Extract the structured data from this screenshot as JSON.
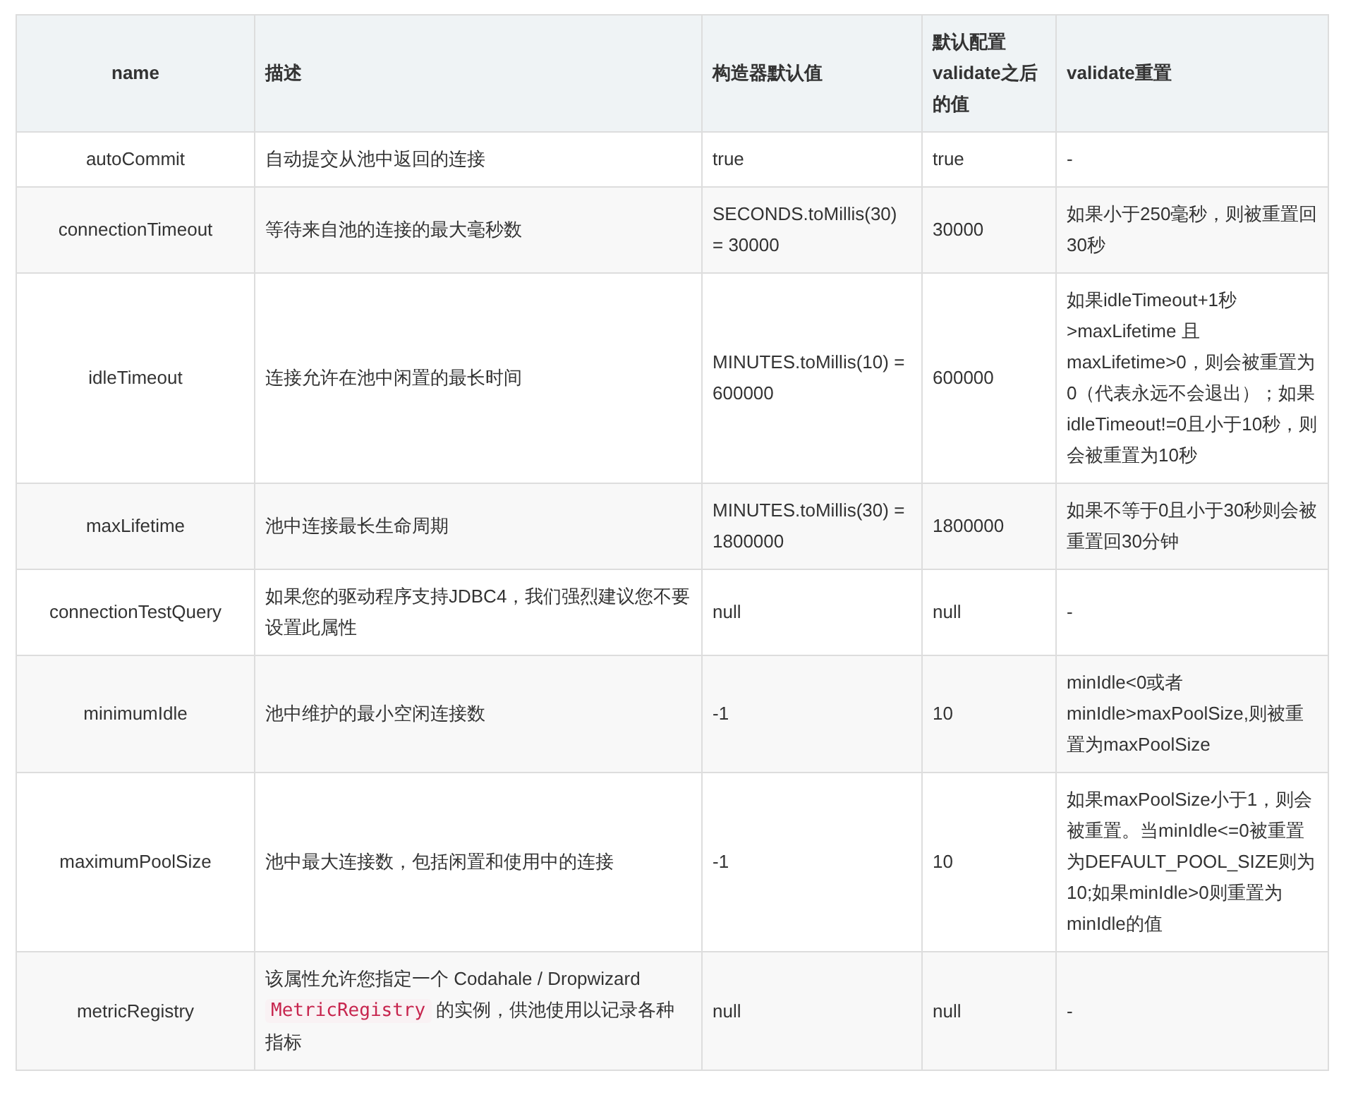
{
  "table": {
    "columns": [
      "name",
      "描述",
      "构造器默认值",
      "默认配置validate之后的值",
      "validate重置"
    ],
    "rows": [
      {
        "name": "autoCommit",
        "description": [
          {
            "kind": "text",
            "text": "自动提交从池中返回的连接"
          }
        ],
        "default": "true",
        "validated": "true",
        "reset": "-"
      },
      {
        "name": "connectionTimeout",
        "description": [
          {
            "kind": "text",
            "text": "等待来自池的连接的最大毫秒数"
          }
        ],
        "default": "SECONDS.toMillis(30) = 30000",
        "validated": "30000",
        "reset": "如果小于250毫秒，则被重置回30秒"
      },
      {
        "name": "idleTimeout",
        "description": [
          {
            "kind": "text",
            "text": "连接允许在池中闲置的最长时间"
          }
        ],
        "default": "MINUTES.toMillis(10) = 600000",
        "validated": "600000",
        "reset": "如果idleTimeout+1秒>maxLifetime 且 maxLifetime>0，则会被重置为0（代表永远不会退出）；如果idleTimeout!=0且小于10秒，则会被重置为10秒"
      },
      {
        "name": "maxLifetime",
        "description": [
          {
            "kind": "text",
            "text": "池中连接最长生命周期"
          }
        ],
        "default": "MINUTES.toMillis(30) = 1800000",
        "validated": "1800000",
        "reset": "如果不等于0且小于30秒则会被重置回30分钟"
      },
      {
        "name": "connectionTestQuery",
        "description": [
          {
            "kind": "text",
            "text": "如果您的驱动程序支持JDBC4，我们强烈建议您不要设置此属性"
          }
        ],
        "default": "null",
        "validated": "null",
        "reset": "-"
      },
      {
        "name": "minimumIdle",
        "description": [
          {
            "kind": "text",
            "text": "池中维护的最小空闲连接数"
          }
        ],
        "default": "-1",
        "validated": "10",
        "reset": "minIdle<0或者minIdle>maxPoolSize,则被重置为maxPoolSize"
      },
      {
        "name": "maximumPoolSize",
        "description": [
          {
            "kind": "text",
            "text": "池中最大连接数，包括闲置和使用中的连接"
          }
        ],
        "default": "-1",
        "validated": "10",
        "reset": "如果maxPoolSize小于1，则会被重置。当minIdle<=0被重置为DEFAULT_POOL_SIZE则为10;如果minIdle>0则重置为minIdle的值"
      },
      {
        "name": "metricRegistry",
        "description": [
          {
            "kind": "text",
            "text": "该属性允许您指定一个 Codahale / Dropwizard "
          },
          {
            "kind": "code",
            "text": "MetricRegistry"
          },
          {
            "kind": "text",
            "text": " 的实例，供池使用以记录各种指标"
          }
        ],
        "default": "null",
        "validated": "null",
        "reset": "-"
      }
    ]
  }
}
